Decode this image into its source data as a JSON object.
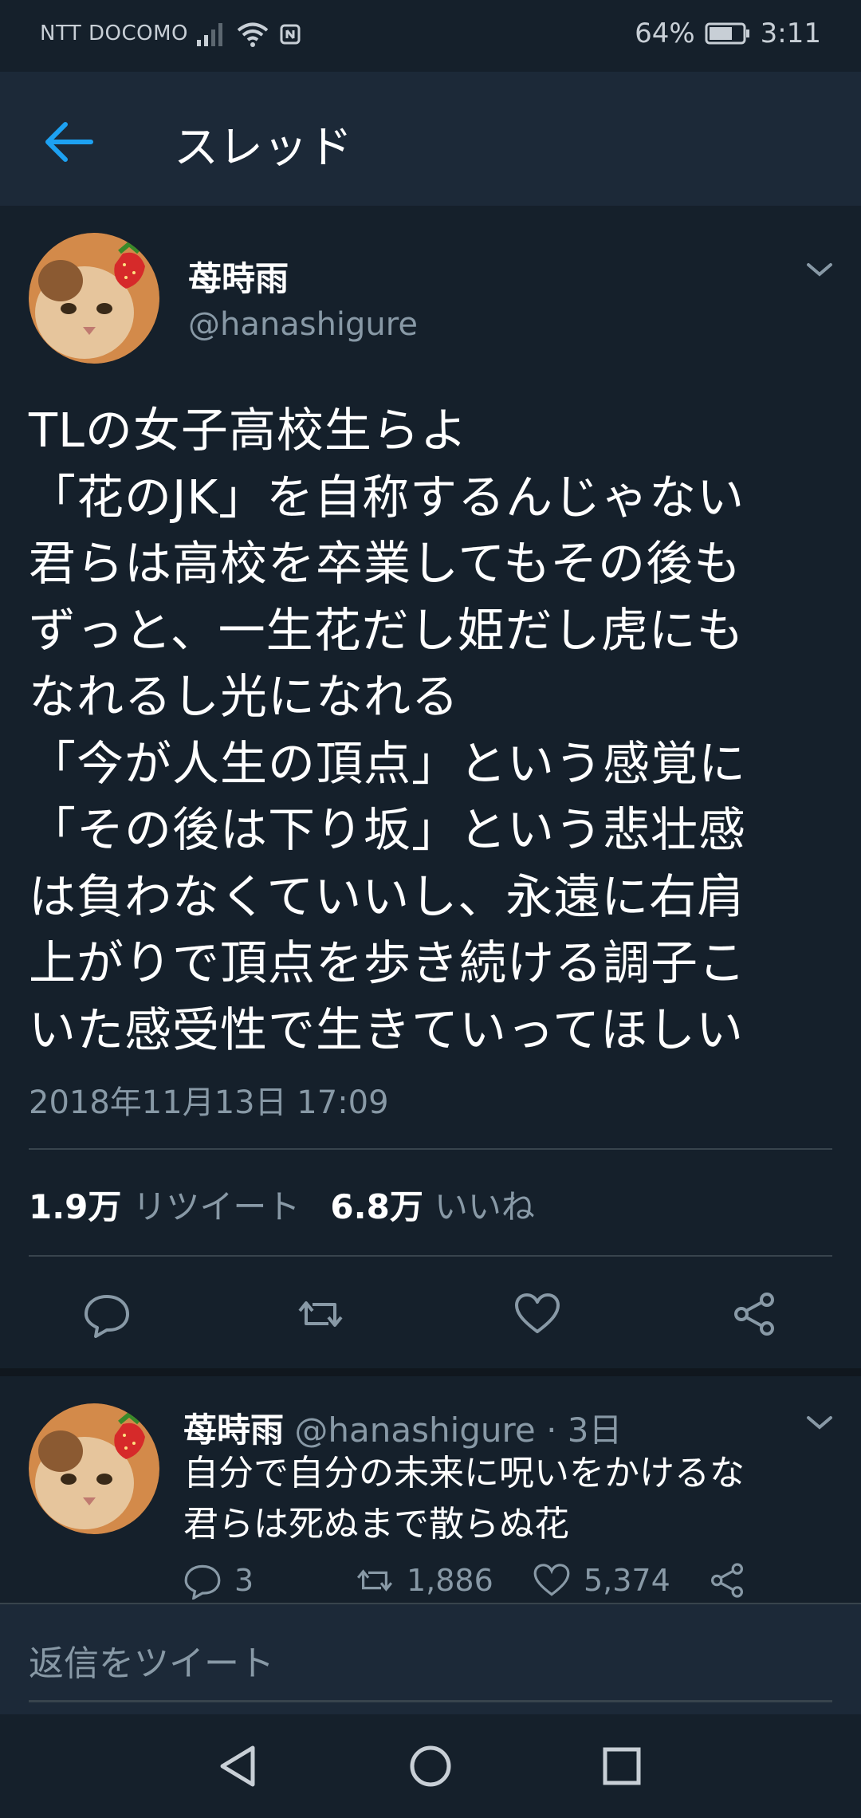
{
  "status_bar": {
    "carrier": "NTT DOCOMO",
    "battery": "64%",
    "time": "3:11"
  },
  "header": {
    "title": "スレッド",
    "accent": "#1da1f2"
  },
  "tweet": {
    "name": "苺時雨",
    "handle": "@hanashigure",
    "text": "TLの女子高校生らよ\n「花のJK」を自称するんじゃない\n君らは高校を卒業してもその後も\nずっと、一生花だし姫だし虎にも\nなれるし光になれる\n「今が人生の頂点」という感覚に\n「その後は下り坂」という悲壮感\nは負わなくていいし、永遠に右肩\n上がりで頂点を歩き続ける調子こ\nいた感受性で生きていってほしい",
    "timestamp": "2018年11月13日 17:09",
    "retweet_count": "1.9万",
    "retweet_label": "リツイート",
    "like_count": "6.8万",
    "like_label": "いいね"
  },
  "reply": {
    "name": "苺時雨",
    "meta": "@hanashigure · 3日",
    "text": "自分で自分の未来に呪いをかけるな\n君らは死ぬまで散らぬ花",
    "reply_count": "3",
    "retweet_count": "1,886",
    "like_count": "5,374"
  },
  "compose": {
    "placeholder": "返信をツイート"
  },
  "colors": {
    "background": "#15202b",
    "header": "#1c2938",
    "secondary_text": "#8899a6",
    "divider": "#38444d"
  }
}
